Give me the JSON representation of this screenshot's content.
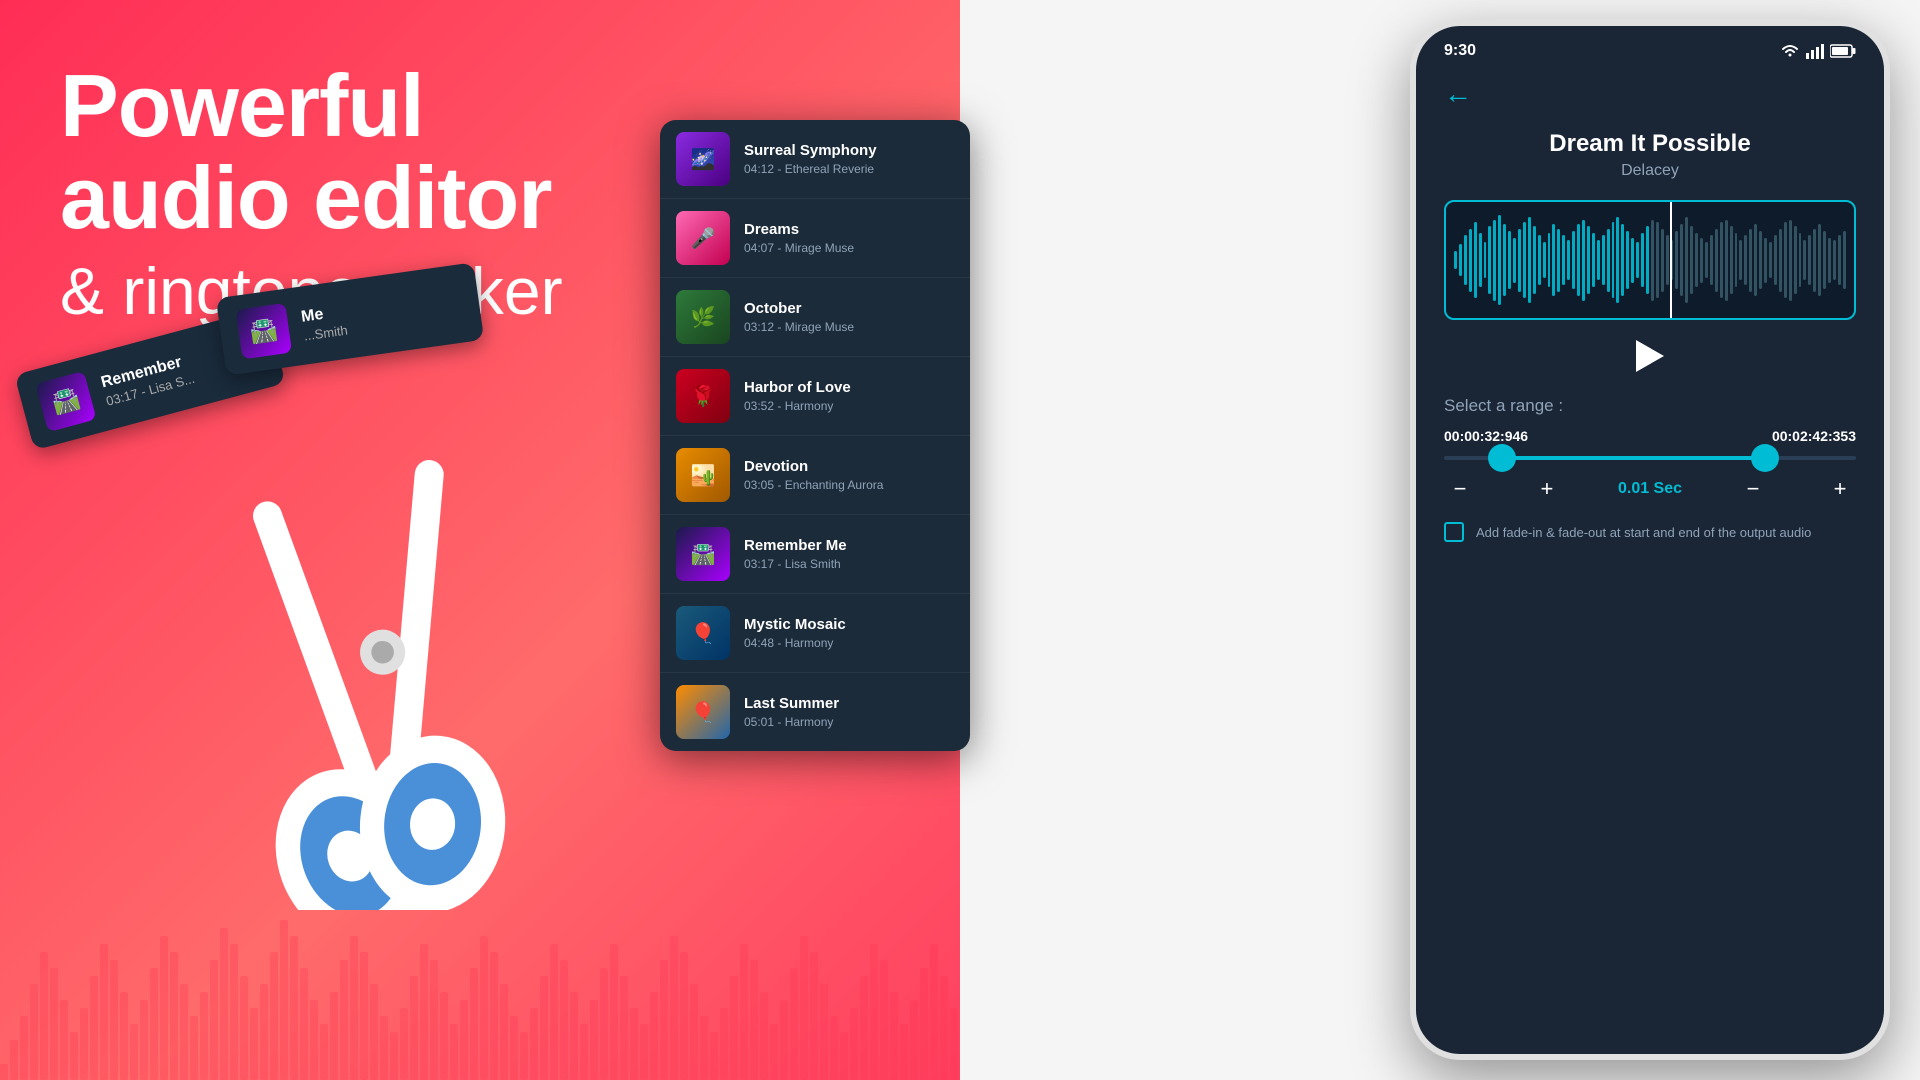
{
  "hero": {
    "line1": "Powerful",
    "line2": "audio editor",
    "line3": "& ringtone maker"
  },
  "cutCards": [
    {
      "title": "Remember",
      "meta": "03:17 - Lisa S...",
      "thumbEmoji": "🛣️"
    },
    {
      "title": "Me",
      "meta": "...Smith",
      "thumbEmoji": "🛣️"
    }
  ],
  "musicList": [
    {
      "title": "Surreal Symphony",
      "meta": "04:12 - Ethereal Reverie",
      "thumbClass": "thumb-purple",
      "emoji": "🌌"
    },
    {
      "title": "Dreams",
      "meta": "04:07 - Mirage Muse",
      "thumbClass": "thumb-pink",
      "emoji": "🎤"
    },
    {
      "title": "October",
      "meta": "03:12 - Mirage Muse",
      "thumbClass": "thumb-green",
      "emoji": "🌿"
    },
    {
      "title": "Harbor of Love",
      "meta": "03:52 - Harmony",
      "thumbClass": "thumb-red",
      "emoji": "🌹"
    },
    {
      "title": "Devotion",
      "meta": "03:05 - Enchanting Aurora",
      "thumbClass": "thumb-orange",
      "emoji": "🏜️"
    },
    {
      "title": "Remember Me",
      "meta": "03:17 - Lisa Smith",
      "thumbClass": "thumb-highway",
      "emoji": "🛣️"
    },
    {
      "title": "Mystic Mosaic",
      "meta": "04:48 - Harmony",
      "thumbClass": "thumb-mosaic",
      "emoji": "🎈"
    },
    {
      "title": "Last Summer",
      "meta": "05:01 - Harmony",
      "thumbClass": "thumb-balloon",
      "emoji": "🎈"
    }
  ],
  "phone": {
    "statusTime": "9:30",
    "songTitle": "Dream It Possible",
    "artist": "Delacey",
    "backArrow": "←",
    "selectRange": "Select a range :",
    "timeLeft": "00:00:32:946",
    "timeRight": "00:02:42:353",
    "fineStep": "0.01 Sec",
    "fadeLabelMinus1": "−",
    "fadeLabelPlus1": "+",
    "fadeLabelMinus2": "−",
    "fadeLabelPlus2": "+",
    "fadeText": "Add fade-in & fade-out at start and end of the output audio"
  }
}
